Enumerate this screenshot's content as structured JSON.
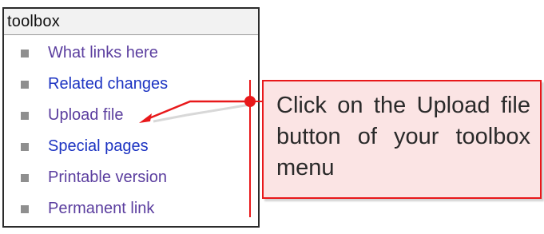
{
  "toolbox": {
    "title": "toolbox",
    "items": [
      {
        "label": "What links here",
        "style": "visited"
      },
      {
        "label": "Related changes",
        "style": "link"
      },
      {
        "label": "Upload file",
        "style": "visited"
      },
      {
        "label": "Special pages",
        "style": "link"
      },
      {
        "label": "Printable version",
        "style": "visited"
      },
      {
        "label": "Permanent link",
        "style": "visited"
      }
    ]
  },
  "callout": {
    "text": "Click on the Upload file button of your toolbox menu"
  },
  "colors": {
    "accent": "#e8181a",
    "callout_bg": "#fbe4e4",
    "link": "#1c33c2",
    "visited": "#5b3e9f",
    "bullet": "#8f8f8f"
  }
}
